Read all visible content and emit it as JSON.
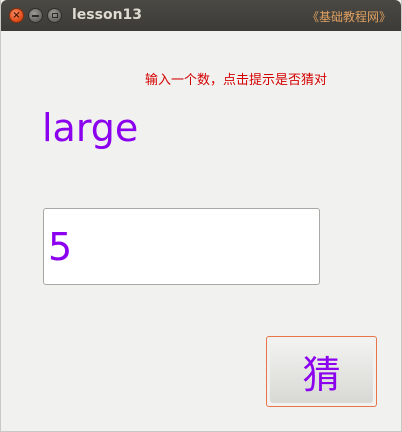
{
  "window": {
    "title": "lesson13",
    "watermark": "《基础教程网》",
    "controls": {
      "close_glyph": "×"
    }
  },
  "main": {
    "hint": "输入一个数，点击提示是否猜对",
    "result": "large",
    "input_value": "5",
    "guess_label": "猜"
  },
  "colors": {
    "text_accent": "#8b00ee",
    "hint": "#d40000",
    "button_focus": "#e8744a"
  }
}
